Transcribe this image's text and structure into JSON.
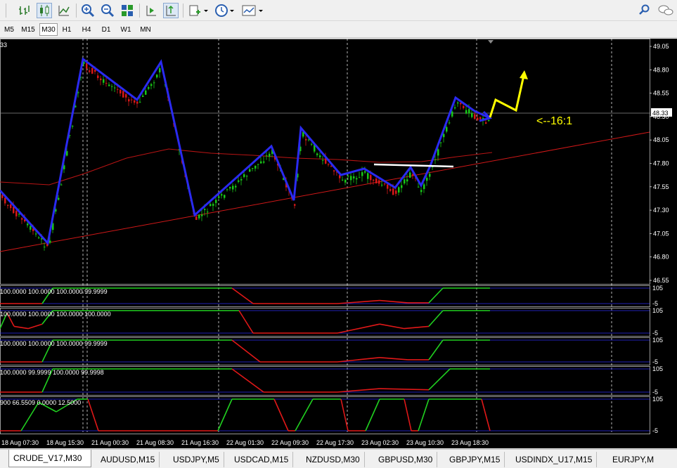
{
  "symbol_price_label": "48.33",
  "corner_label": "33",
  "timeframes": [
    "M5",
    "M15",
    "M30",
    "H1",
    "H4",
    "D1",
    "W1",
    "MN"
  ],
  "active_timeframe": "M30",
  "price_axis": [
    "49.05",
    "48.80",
    "48.55",
    "48.30",
    "48.05",
    "47.80",
    "47.55",
    "47.30",
    "47.05",
    "46.80",
    "46.55"
  ],
  "current_price": "48.33",
  "annotation": "<--16:1",
  "time_axis": [
    "18 Aug 07:30",
    "18 Aug 15:30",
    "21 Aug 00:30",
    "21 Aug 08:30",
    "21 Aug 16:30",
    "22 Aug 01:30",
    "22 Aug 09:30",
    "22 Aug 17:30",
    "23 Aug 02:30",
    "23 Aug 10:30",
    "23 Aug 18:30"
  ],
  "indicators": [
    {
      "label": "100.0000 100.0000 100.0000 99.9999",
      "level_high": "105",
      "level_low": "-5"
    },
    {
      "label": "100.0000 100.0000 100.0000 100.0000",
      "level_high": "105",
      "level_low": "-5"
    },
    {
      "label": "100.0000 100.0000 100.0000 99.9999",
      "level_high": "105",
      "level_low": "-5"
    },
    {
      "label": "100.0000 99.9999 100.0000 99.9998",
      "level_high": "105",
      "level_low": "-5"
    },
    {
      "label": "900 66.5509 0.0000 12.5000",
      "level_high": "105",
      "level_low": "-5"
    }
  ],
  "tabs": [
    "CRUDE_V17,M30",
    "AUDUSD,M15",
    "USDJPY,M5",
    "USDCAD,M15",
    "NZDUSD,M30",
    "GBPUSD,M30",
    "GBPJPY,M15",
    "USDINDX_U17,M15",
    "EURJPY,M"
  ],
  "active_tab": "CRUDE_V17,M30",
  "colors": {
    "background": "#000000",
    "zigzag": "#2a2af0",
    "ma": "#c81818",
    "projection": "#ffff00",
    "bull_candle": "#18c818",
    "bear_candle": "#d81818",
    "axis_text": "#ffffff"
  },
  "icons": [
    "bar-chart-icon",
    "candlestick-icon",
    "line-chart-icon",
    "zoom-in-icon",
    "zoom-out-icon",
    "tile-windows-icon",
    "autoscroll-icon",
    "chart-shift-icon",
    "new-order-icon",
    "clock-icon",
    "template-icon",
    "search-icon",
    "chat-icon"
  ]
}
